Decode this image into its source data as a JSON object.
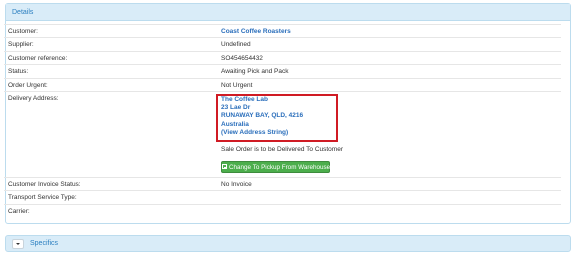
{
  "details": {
    "heading": "Details",
    "rows": [
      {
        "label": "Customer:",
        "value": "Coast Coffee Roasters"
      },
      {
        "label": "Supplier:",
        "value": "Undefined"
      },
      {
        "label": "Customer reference:",
        "value": "SO454654432"
      },
      {
        "label": "Status:",
        "value": "Awaiting Pick and Pack"
      },
      {
        "label": "Order Urgent:",
        "value": "Not Urgent"
      }
    ],
    "delivery": {
      "label": "Delivery Address:",
      "address_lines": [
        "The Coffee Lab",
        "23 Lae Dr",
        "RUNAWAY BAY, QLD, 4216",
        "Australia",
        "(View Address String)"
      ],
      "note": "Sale Order is to be Delivered To Customer",
      "button_label": "Change To Pickup From Warehouse"
    },
    "rows_after": [
      {
        "label": "Customer Invoice Status:",
        "value": "No Invoice"
      },
      {
        "label": "Transport Service Type:",
        "value": ""
      },
      {
        "label": "Carrier:",
        "value": ""
      }
    ]
  },
  "specifics": {
    "label": "Specifics"
  },
  "colors": {
    "accent": "#2b7fc0",
    "link": "#2a6ebb",
    "highlight_border": "#d01b24",
    "button": "#4cae4c"
  }
}
